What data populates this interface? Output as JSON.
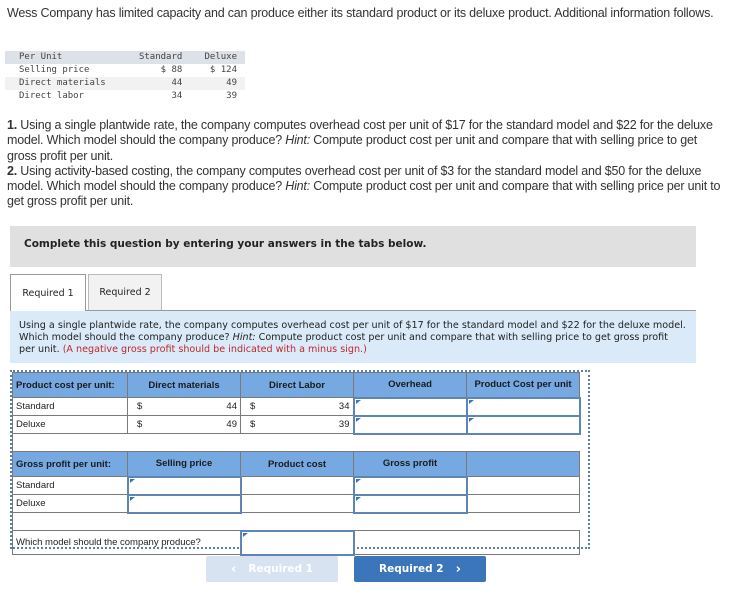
{
  "intro": "Wess Company has limited capacity and can produce either its standard product or its deluxe product. Additional information follows.",
  "given_table": {
    "headers": [
      "Per Unit",
      "Standard",
      "Deluxe"
    ],
    "rows": [
      [
        "Selling price",
        "$ 88",
        "$ 124"
      ],
      [
        "Direct materials",
        "44",
        "49"
      ],
      [
        "Direct labor",
        "34",
        "39"
      ]
    ]
  },
  "questions": {
    "q1_num": "1.",
    "q1_text": " Using a single plantwide rate, the company computes overhead cost per unit of $17 for the standard model and $22 for the deluxe model. Which model should the company produce? ",
    "hint_label": "Hint:",
    "q1_hint": " Compute product cost per unit and compare that with selling price to get gross profit per unit.",
    "q2_num": "2.",
    "q2_text": " Using activity-based costing, the company computes overhead cost per unit of $3 for the standard model and $50 for the deluxe model. Which model should the company produce? ",
    "q2_hint": " Compute product cost per unit and compare that with selling price per unit to get gross profit per unit."
  },
  "complete_instruction": "Complete this question by entering your answers in the tabs below.",
  "tabs": [
    {
      "label": "Required 1",
      "active": true
    },
    {
      "label": "Required 2",
      "active": false
    }
  ],
  "info_box": {
    "text": "Using a single plantwide rate, the company computes overhead cost per unit of $17 for the standard model and $22 for the deluxe model. Which model should the company produce? ",
    "hint_label": "Hint:",
    "hint_text": " Compute product cost per unit and compare that with selling price to get gross profit per unit. ",
    "note": "(A negative gross profit should be indicated with a minus sign.)"
  },
  "product_cost_table": {
    "headers": [
      "Product cost per unit:",
      "Direct materials",
      "Direct Labor",
      "Overhead",
      "Product Cost per unit"
    ],
    "rows": [
      {
        "label": "Standard",
        "dm_sign": "$",
        "dm": "44",
        "dl_sign": "$",
        "dl": "34",
        "overhead": "",
        "product_cost": ""
      },
      {
        "label": "Deluxe",
        "dm_sign": "$",
        "dm": "49",
        "dl_sign": "$",
        "dl": "39",
        "overhead": "",
        "product_cost": ""
      }
    ]
  },
  "gross_profit_table": {
    "headers": [
      "Gross profit per unit:",
      "Selling price",
      "Product cost",
      "Gross profit",
      ""
    ],
    "rows": [
      {
        "label": "Standard",
        "selling_price": "",
        "product_cost": "",
        "gross_profit": ""
      },
      {
        "label": "Deluxe",
        "selling_price": "",
        "product_cost": "",
        "gross_profit": ""
      }
    ]
  },
  "model_question": {
    "label": "Which model should the company produce?",
    "answer": ""
  },
  "nav": {
    "prev_label": "Required 1",
    "next_label": "Required 2",
    "prev_icon": "‹",
    "next_icon": "›"
  }
}
